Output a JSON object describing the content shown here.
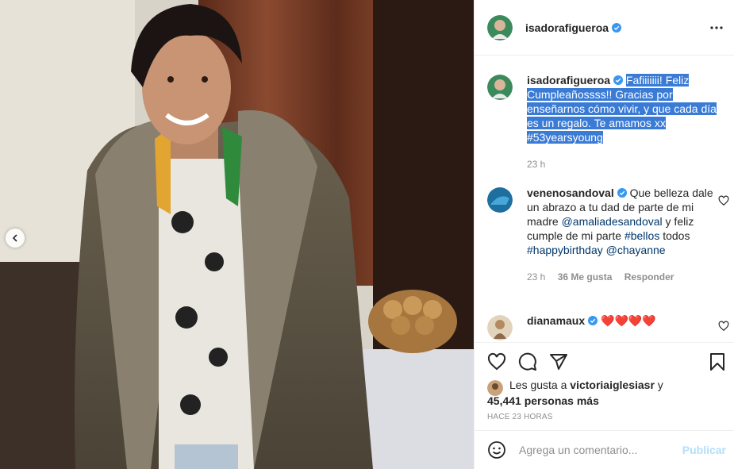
{
  "post": {
    "author": "isadorafigueroa",
    "caption": {
      "username": "isadorafigueroa",
      "text": "Fafiiiiiii! Feliz Cumpleañossss!! Gracias por enseñarnos cómo vivir, y que cada día es un regalo. Te amamos xx #53yearsyoung",
      "time": "23 h"
    },
    "comments": [
      {
        "username": "venenosandoval",
        "text_a": "Que belleza dale un abrazo a tu dad de parte de mi madre ",
        "mention_1": "@amaliadesandoval",
        "text_b": " y feliz cumple de mi parte ",
        "tag_1": "#bellos",
        "text_c": " todos ",
        "tag_2": "#happybirthday",
        "text_d": " ",
        "mention_2": "@chayanne",
        "time": "23 h",
        "likes": "36 Me gusta",
        "reply": "Responder"
      },
      {
        "username": "dianamaux",
        "text": "❤️❤️❤️❤️"
      }
    ],
    "likes_line_1": "Les gusta a ",
    "likes_user": "victoriaiglesiasr",
    "likes_and": " y",
    "likes_line_2": "45,441 personas más",
    "timestamp": "Hace 23 horas",
    "comment_placeholder": "Agrega un comentario...",
    "publish_label": "Publicar"
  },
  "colors": {
    "highlight": "#3a7bd5",
    "verified": "#3897f0",
    "link": "#00376b",
    "publish_disabled": "#b2dffc",
    "heart_red": "#ed4956"
  },
  "icons": [
    "verified-icon",
    "more-options-icon",
    "heart-icon",
    "comment-icon",
    "share-icon",
    "bookmark-icon",
    "emoji-icon",
    "chevron-left-icon"
  ]
}
